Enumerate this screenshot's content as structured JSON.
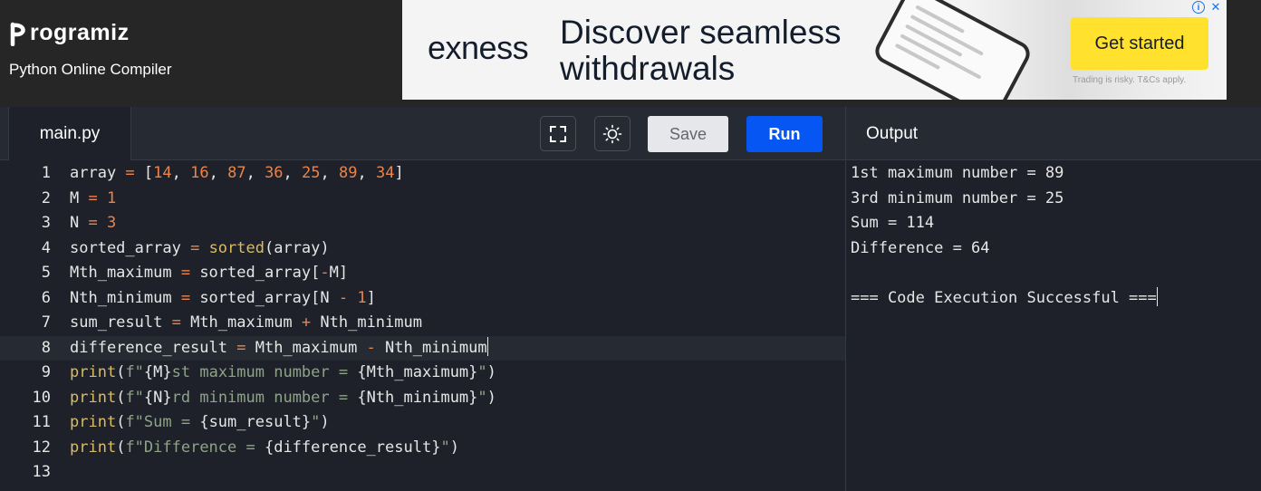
{
  "header": {
    "logo_text": "rogramiz",
    "subtitle": "Python Online Compiler"
  },
  "ad": {
    "brand": "exness",
    "headline": "Discover seamless withdrawals",
    "cta": "Get started",
    "disclaimer": "Trading is risky. T&Cs apply.",
    "info_icon": "info-icon",
    "close_icon": "close-icon"
  },
  "editor": {
    "tab_label": "main.py",
    "fullscreen_icon": "fullscreen-icon",
    "theme_icon": "sun-icon",
    "save_label": "Save",
    "run_label": "Run",
    "active_line": 8,
    "line_numbers": [
      "1",
      "2",
      "3",
      "4",
      "5",
      "6",
      "7",
      "8",
      "9",
      "10",
      "11",
      "12",
      "13"
    ],
    "lines": [
      [
        {
          "t": "array ",
          "c": "var"
        },
        {
          "t": "=",
          "c": "op"
        },
        {
          "t": " [",
          "c": "punc"
        },
        {
          "t": "14",
          "c": "num"
        },
        {
          "t": ", ",
          "c": "punc"
        },
        {
          "t": "16",
          "c": "num"
        },
        {
          "t": ", ",
          "c": "punc"
        },
        {
          "t": "87",
          "c": "num"
        },
        {
          "t": ", ",
          "c": "punc"
        },
        {
          "t": "36",
          "c": "num"
        },
        {
          "t": ", ",
          "c": "punc"
        },
        {
          "t": "25",
          "c": "num"
        },
        {
          "t": ", ",
          "c": "punc"
        },
        {
          "t": "89",
          "c": "num"
        },
        {
          "t": ", ",
          "c": "punc"
        },
        {
          "t": "34",
          "c": "num"
        },
        {
          "t": "]",
          "c": "punc"
        }
      ],
      [
        {
          "t": "M ",
          "c": "var"
        },
        {
          "t": "=",
          "c": "op"
        },
        {
          "t": " ",
          "c": "punc"
        },
        {
          "t": "1",
          "c": "num"
        }
      ],
      [
        {
          "t": "N ",
          "c": "var"
        },
        {
          "t": "=",
          "c": "op"
        },
        {
          "t": " ",
          "c": "punc"
        },
        {
          "t": "3",
          "c": "num"
        }
      ],
      [
        {
          "t": "sorted_array ",
          "c": "var"
        },
        {
          "t": "=",
          "c": "op"
        },
        {
          "t": " ",
          "c": "punc"
        },
        {
          "t": "sorted",
          "c": "fn"
        },
        {
          "t": "(array)",
          "c": "punc"
        }
      ],
      [
        {
          "t": "Mth_maximum ",
          "c": "var"
        },
        {
          "t": "=",
          "c": "op"
        },
        {
          "t": " sorted_array[",
          "c": "punc"
        },
        {
          "t": "-",
          "c": "op"
        },
        {
          "t": "M]",
          "c": "punc"
        }
      ],
      [
        {
          "t": "Nth_minimum ",
          "c": "var"
        },
        {
          "t": "=",
          "c": "op"
        },
        {
          "t": " sorted_array[N ",
          "c": "punc"
        },
        {
          "t": "-",
          "c": "op"
        },
        {
          "t": " ",
          "c": "punc"
        },
        {
          "t": "1",
          "c": "num"
        },
        {
          "t": "]",
          "c": "punc"
        }
      ],
      [
        {
          "t": "sum_result ",
          "c": "var"
        },
        {
          "t": "=",
          "c": "op"
        },
        {
          "t": " Mth_maximum ",
          "c": "punc"
        },
        {
          "t": "+",
          "c": "op"
        },
        {
          "t": " Nth_minimum",
          "c": "punc"
        }
      ],
      [
        {
          "t": "difference_result ",
          "c": "var"
        },
        {
          "t": "=",
          "c": "op"
        },
        {
          "t": " Mth_maximum ",
          "c": "punc"
        },
        {
          "t": "-",
          "c": "op"
        },
        {
          "t": " Nth_minimum",
          "c": "punc"
        }
      ],
      [
        {
          "t": "print",
          "c": "fn"
        },
        {
          "t": "(",
          "c": "punc"
        },
        {
          "t": "f\"",
          "c": "str"
        },
        {
          "t": "{M}",
          "c": "punc"
        },
        {
          "t": "st maximum number = ",
          "c": "str"
        },
        {
          "t": "{Mth_maximum}",
          "c": "punc"
        },
        {
          "t": "\"",
          "c": "str"
        },
        {
          "t": ")",
          "c": "punc"
        }
      ],
      [
        {
          "t": "print",
          "c": "fn"
        },
        {
          "t": "(",
          "c": "punc"
        },
        {
          "t": "f\"",
          "c": "str"
        },
        {
          "t": "{N}",
          "c": "punc"
        },
        {
          "t": "rd minimum number = ",
          "c": "str"
        },
        {
          "t": "{Nth_minimum}",
          "c": "punc"
        },
        {
          "t": "\"",
          "c": "str"
        },
        {
          "t": ")",
          "c": "punc"
        }
      ],
      [
        {
          "t": "print",
          "c": "fn"
        },
        {
          "t": "(",
          "c": "punc"
        },
        {
          "t": "f\"Sum = ",
          "c": "str"
        },
        {
          "t": "{sum_result}",
          "c": "punc"
        },
        {
          "t": "\"",
          "c": "str"
        },
        {
          "t": ")",
          "c": "punc"
        }
      ],
      [
        {
          "t": "print",
          "c": "fn"
        },
        {
          "t": "(",
          "c": "punc"
        },
        {
          "t": "f\"Difference = ",
          "c": "str"
        },
        {
          "t": "{difference_result}",
          "c": "punc"
        },
        {
          "t": "\"",
          "c": "str"
        },
        {
          "t": ")",
          "c": "punc"
        }
      ],
      []
    ]
  },
  "output": {
    "title": "Output",
    "lines": [
      "1st maximum number = 89",
      "3rd minimum number = 25",
      "Sum = 114",
      "Difference = 64",
      "",
      "=== Code Execution Successful ==="
    ]
  }
}
